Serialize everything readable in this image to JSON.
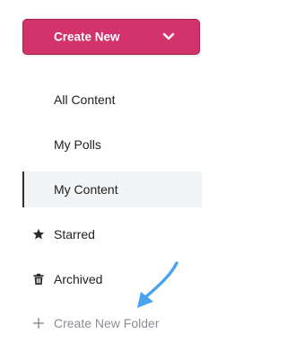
{
  "create_button": {
    "label": "Create New",
    "icon": "chevron-down-icon",
    "color": "#d2336b"
  },
  "nav": {
    "items": [
      {
        "label": "All Content",
        "active": false
      },
      {
        "label": "My Polls",
        "active": false
      },
      {
        "label": "My Content",
        "active": true
      },
      {
        "label": "Starred",
        "icon": "star-icon"
      },
      {
        "label": "Archived",
        "icon": "trash-icon"
      },
      {
        "label": "Create New Folder",
        "icon": "plus-icon"
      }
    ]
  },
  "annotation": {
    "icon": "pointer-arrow-icon",
    "color": "#4aa3f0"
  }
}
